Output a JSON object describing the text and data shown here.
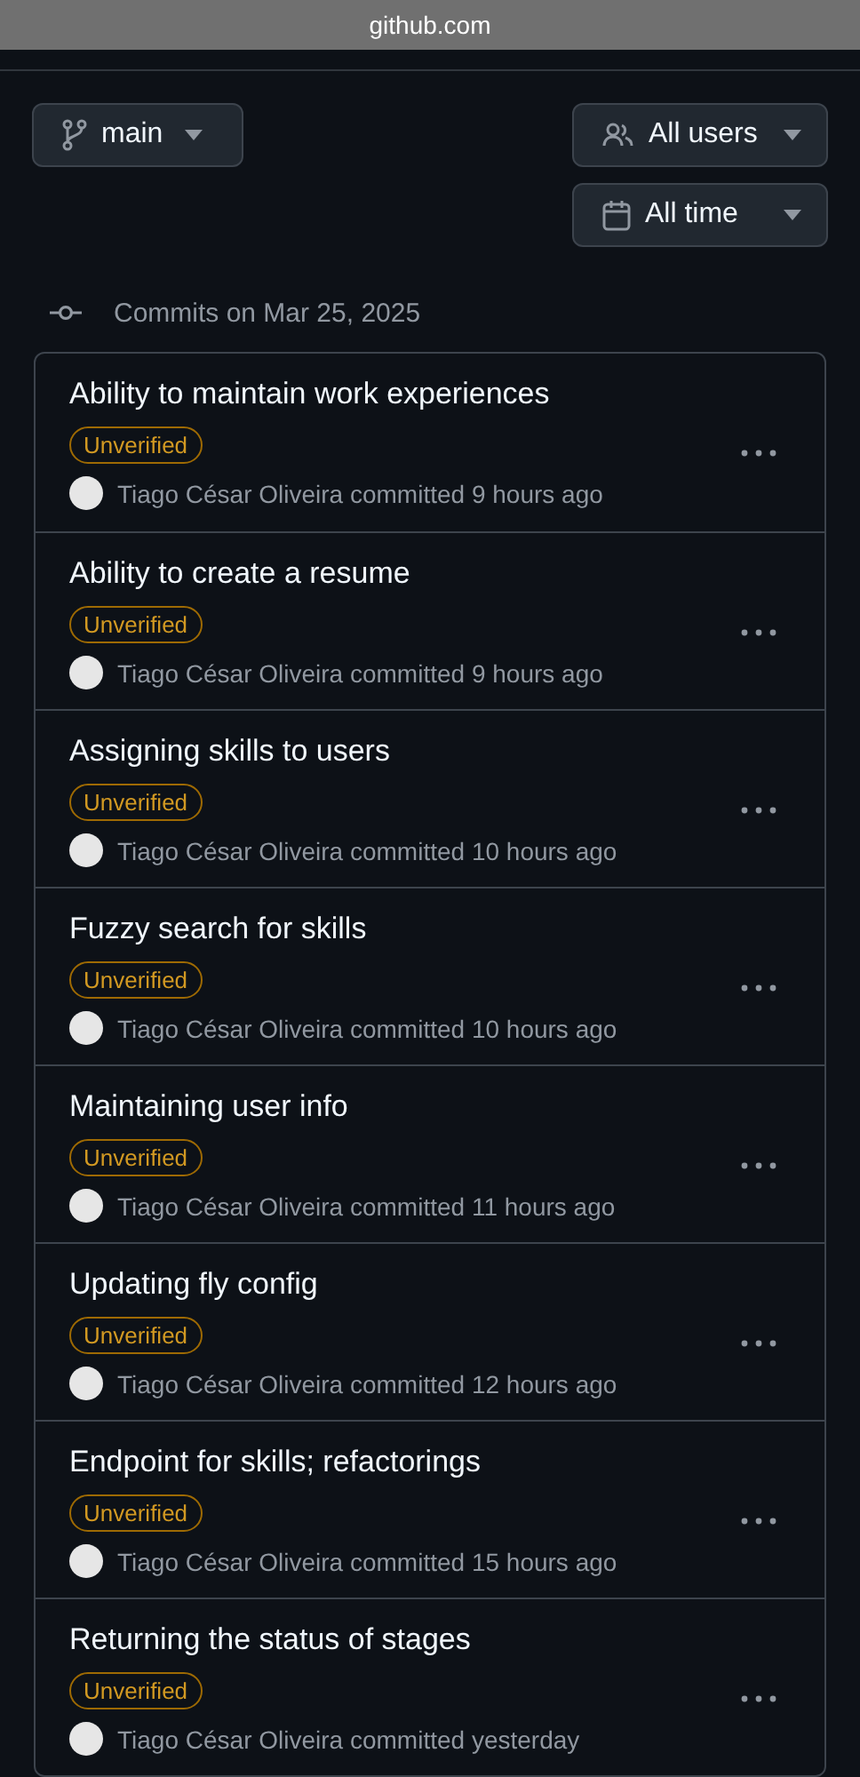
{
  "browser_bar": {
    "url": "github.com"
  },
  "branch_button": {
    "label": "main"
  },
  "filters": [
    {
      "kind": "users",
      "label": "All users"
    },
    {
      "kind": "time",
      "label": "All time"
    }
  ],
  "commit_group": {
    "heading": "Commits on Mar 25, 2025"
  },
  "commits": [
    {
      "title": "Ability to maintain work experiences",
      "badge": "Unverified",
      "author": "Tiago César Oliveira",
      "meta": "committed 9 hours ago"
    },
    {
      "title": "Ability to create a resume",
      "badge": "Unverified",
      "author": "Tiago César Oliveira",
      "meta": "committed 9 hours ago"
    },
    {
      "title": "Assigning skills to users",
      "badge": "Unverified",
      "author": "Tiago César Oliveira",
      "meta": "committed 10 hours ago"
    },
    {
      "title": "Fuzzy search for skills",
      "badge": "Unverified",
      "author": "Tiago César Oliveira",
      "meta": "committed 10 hours ago"
    },
    {
      "title": "Maintaining user info",
      "badge": "Unverified",
      "author": "Tiago César Oliveira",
      "meta": "committed 11 hours ago"
    },
    {
      "title": "Updating fly config",
      "badge": "Unverified",
      "author": "Tiago César Oliveira",
      "meta": "committed 12 hours ago"
    },
    {
      "title": "Endpoint for skills; refactorings",
      "badge": "Unverified",
      "author": "Tiago César Oliveira",
      "meta": "committed 15 hours ago"
    },
    {
      "title": "Returning the status of stages",
      "badge": "Unverified",
      "author": "Tiago César Oliveira",
      "meta": "committed yesterday"
    }
  ]
}
